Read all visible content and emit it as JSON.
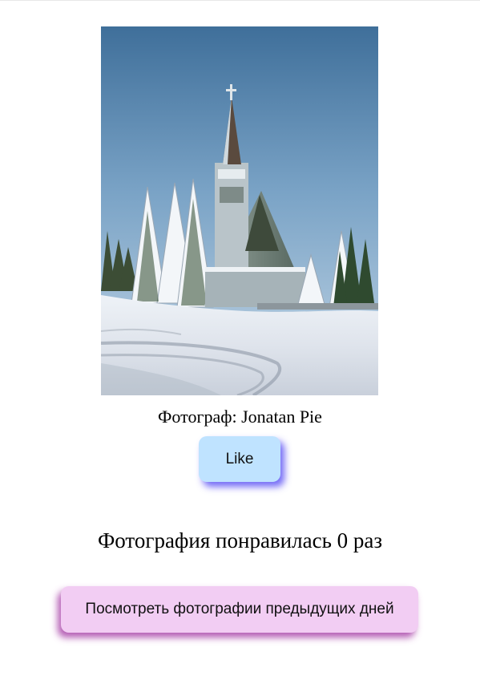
{
  "photo": {
    "alt": "Фотограф: Jonatan Pie",
    "caption": "Фотограф: Jonatan Pie"
  },
  "like_button": {
    "label": "Like"
  },
  "likes": {
    "text": "Фотография понравилась 0 раз",
    "count": 0
  },
  "previous_days_button": {
    "label": "Посмотреть фотографии предыдущих дней"
  },
  "colors": {
    "like_button_bg": "#bfe3ff",
    "like_button_shadow": "#5a50f5",
    "prev_button_bg": "#f2cdf3",
    "prev_button_shadow": "#a032a0"
  }
}
